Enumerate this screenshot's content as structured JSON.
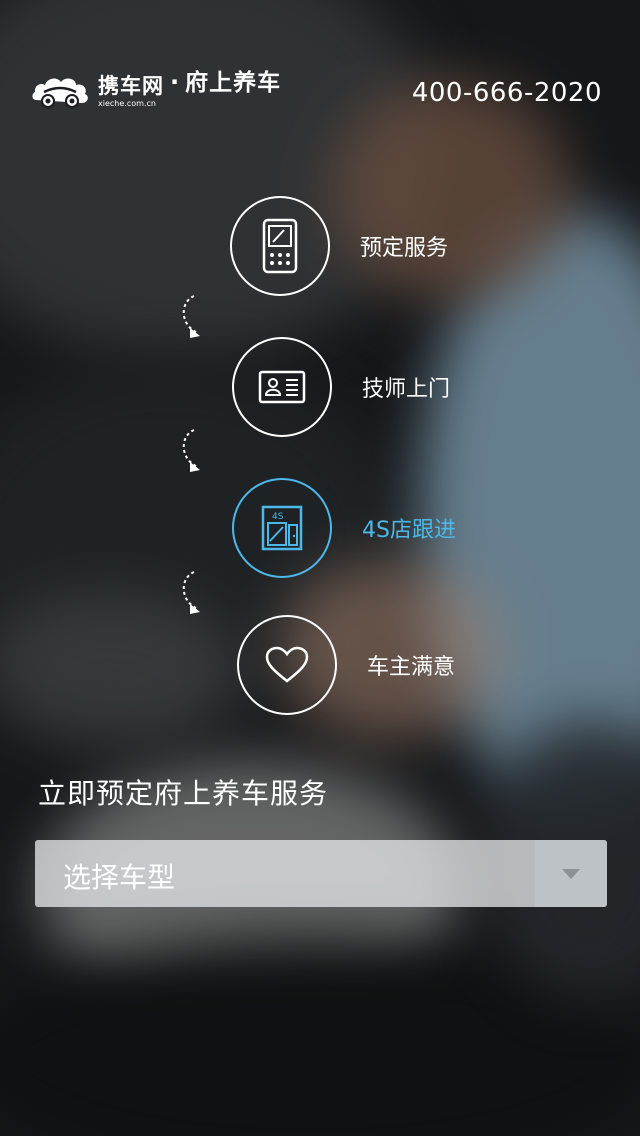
{
  "header": {
    "brand": "携车网",
    "brand_url": "xieche.com.cn",
    "separator": "·",
    "slogan": "府上养车",
    "phone": "400-666-2020"
  },
  "steps": [
    {
      "label": "预定服务",
      "icon": "phone-booking-icon",
      "active": false
    },
    {
      "label": "技师上门",
      "icon": "id-card-icon",
      "active": false
    },
    {
      "label": "4S店跟进",
      "icon": "4s-store-icon",
      "active": true,
      "icon_text": "4S"
    },
    {
      "label": "车主满意",
      "icon": "heart-icon",
      "active": false
    }
  ],
  "colors": {
    "accent": "#4cb8ea",
    "text": "#ffffff"
  },
  "booking": {
    "title": "立即预定府上养车服务",
    "select_placeholder": "选择车型"
  }
}
